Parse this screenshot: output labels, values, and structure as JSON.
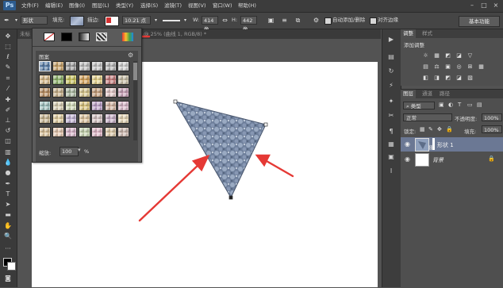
{
  "app": {
    "logo": "Ps"
  },
  "menu": [
    "文件(F)",
    "编辑(E)",
    "图像(I)",
    "图层(L)",
    "类型(Y)",
    "选择(S)",
    "滤镜(T)",
    "视图(V)",
    "窗口(W)",
    "帮助(H)"
  ],
  "window_controls": [
    "–",
    "□",
    "×"
  ],
  "options": {
    "mode": "形状",
    "fill_label": "填充:",
    "stroke_label": "描边:",
    "stroke_width": "10.21 点",
    "w_label": "W:",
    "w_value": "414 像",
    "h_label": "H:",
    "h_value": "442 像",
    "auto_add_delete": "自动添加/删除",
    "align_edges": "对齐边缘",
    "workspace": "基本功能"
  },
  "document": {
    "tab_title_left": "未标",
    "tab_title_right": "@ 25% (曲线 1, RGB/8) *"
  },
  "pattern_popup": {
    "title": "图案",
    "scale_label": "缩放:",
    "scale_value": "100",
    "scale_unit": "%",
    "swatch_colors": [
      "#5a7ea8",
      "#c9a36a",
      "#9b9b9b",
      "#bdbdbd",
      "#c7c7c7",
      "#b5b5b5",
      "#cfcfcf",
      "#d7b98a",
      "#8fb36b",
      "#c9c35f",
      "#d6a45c",
      "#e6d38d",
      "#c67c7c",
      "#c9c0a8",
      "#b98f63",
      "#c9b38e",
      "#a9b8a0",
      "#d9c88f",
      "#c49d7a",
      "#e3c8c8",
      "#c8a2b8",
      "#9fc2c0",
      "#d9d0b4",
      "#cfd8b6",
      "#d8c37c",
      "#bda2c9",
      "#d1b2a0",
      "#d8b8c9",
      "#c9b793",
      "#e3d0a2",
      "#c3b5d6",
      "#e0c6a1",
      "#d6c4c4",
      "#c9b0c9",
      "#e8d8b8",
      "#d9c19a",
      "#e5c8b0",
      "#d7b4c9",
      "#c6d4b0",
      "#e0b8c8",
      "#dcc9a8",
      "#cdb9b0"
    ]
  },
  "panels": {
    "adjust_tabs": [
      "调整",
      "样式"
    ],
    "adjust_title": "添加调整",
    "adjust_icons_row1": [
      "☼",
      "▦",
      "◩",
      "◪",
      "▽"
    ],
    "adjust_icons_row2": [
      "▤",
      "⚖",
      "▣",
      "◎",
      "⊞",
      "▦"
    ],
    "adjust_icons_row3": [
      "◧",
      "◨",
      "◩",
      "◪",
      "▧"
    ],
    "layer_tabs": [
      "图层",
      "通道",
      "路径"
    ],
    "kind_filter": "类型",
    "blend_mode": "正常",
    "opacity_label": "不透明度:",
    "opacity_value": "100%",
    "lock_label": "锁定:",
    "fill_label": "填充:",
    "fill_value": "100%",
    "layers": [
      {
        "name": "形状 1",
        "selected": true
      },
      {
        "name": "背景",
        "selected": false
      }
    ]
  },
  "colors": {
    "arrow_red": "#e53935",
    "triangle_fill": "#7f8ea6"
  }
}
